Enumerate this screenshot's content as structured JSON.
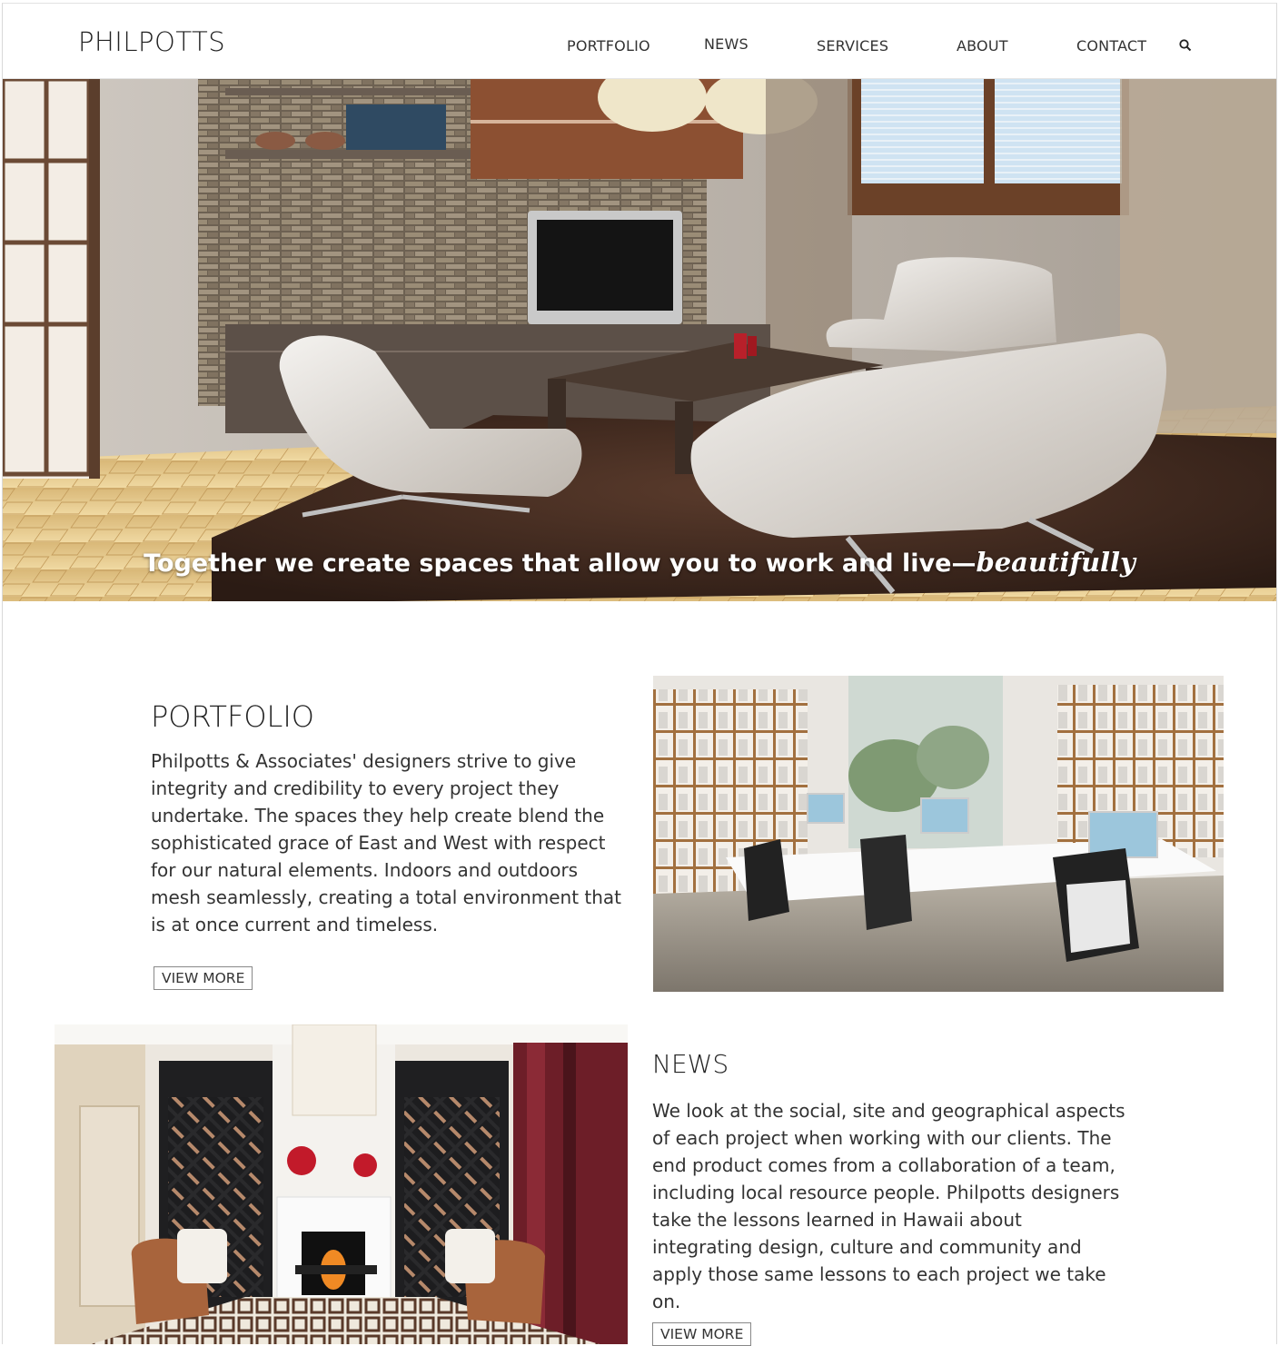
{
  "header": {
    "logo": "PHILPOTTS",
    "nav": [
      "PORTFOLIO",
      "NEWS",
      "SERVICES",
      "ABOUT",
      "CONTACT"
    ],
    "search_icon": "search-icon"
  },
  "hero": {
    "caption_main": "Together we create spaces that allow you to work and live—",
    "caption_em": "beautifully",
    "slides_total": 5,
    "active_slide": 1
  },
  "portfolio": {
    "title": "PORTFOLIO",
    "body": "Philpotts & Associates' designers strive to give integrity and credibility to every project they undertake. The spaces they help create blend the sophisticated grace of East and West with respect for our natural elements. Indoors and outdoors mesh seamlessly, creating a total environment that is at once current and timeless.",
    "button": "VIEW MORE"
  },
  "news": {
    "title": "NEWS",
    "body": "We look at the social, site and geographical aspects of each project when working with our clients. The end product comes from a collaboration of a team, including local resource people. Philpotts designers take the lessons learned in Hawaii about integrating design, culture and community and apply those same lessons to each project we take on.",
    "button": "VIEW MORE"
  },
  "colors": {
    "text": "#222222",
    "border": "#888888",
    "hero_floor": "#e8c98a",
    "hero_rug": "#3f2a20"
  }
}
